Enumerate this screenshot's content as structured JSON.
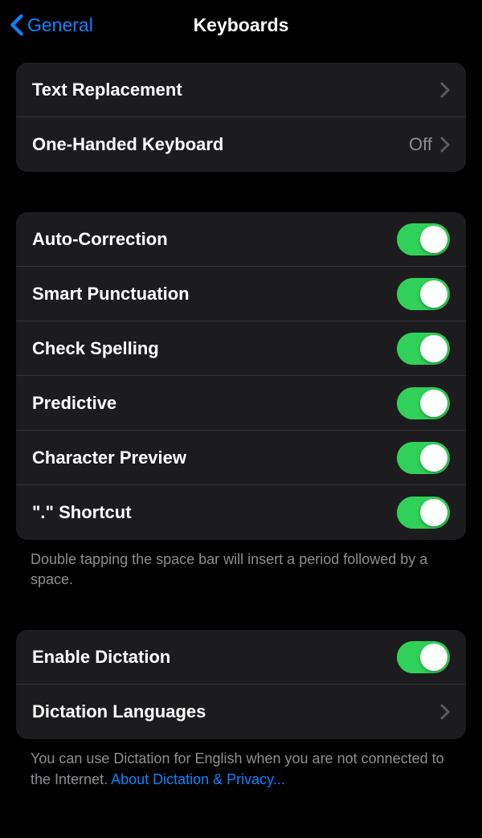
{
  "nav": {
    "back_label": "General",
    "title": "Keyboards"
  },
  "group1": {
    "text_replacement": "Text Replacement",
    "one_handed": "One-Handed Keyboard",
    "one_handed_value": "Off"
  },
  "group2": {
    "auto_correction": "Auto-Correction",
    "smart_punctuation": "Smart Punctuation",
    "check_spelling": "Check Spelling",
    "predictive": "Predictive",
    "character_preview": "Character Preview",
    "period_shortcut": "\".\" Shortcut",
    "footer": "Double tapping the space bar will insert a period followed by a space."
  },
  "group3": {
    "enable_dictation": "Enable Dictation",
    "dictation_languages": "Dictation Languages",
    "footer": "You can use Dictation for English when you are not connected to the Internet. ",
    "footer_link": "About Dictation & Privacy..."
  }
}
